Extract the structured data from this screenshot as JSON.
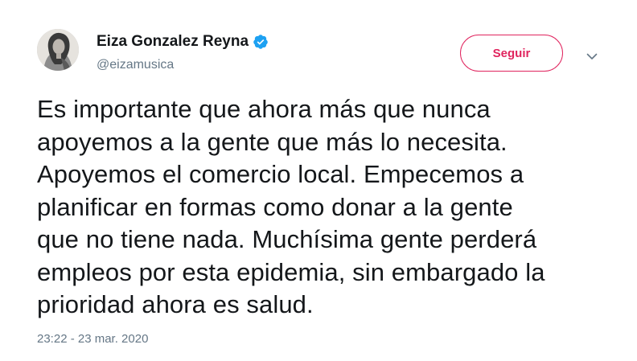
{
  "author": {
    "display_name": "Eiza Gonzalez Reyna",
    "handle": "@eizamusica",
    "verified": true
  },
  "follow_button": {
    "label": "Seguir",
    "color": "#e0245e"
  },
  "tweet": {
    "text": "Es importante que ahora más que nunca\napoyemos a la gente que más lo necesita.\nApoyemos el comercio local. Empecemos a\nplanificar en formas como donar a la gente\nque no tiene nada. Muchísima gente perderá\nempleos por esta epidemia, sin embargado la\nprioridad ahora es salud.",
    "timestamp": "23:22 - 23 mar. 2020"
  },
  "icons": {
    "verified": "verified-badge-icon",
    "caret": "chevron-down-icon"
  },
  "colors": {
    "verified_blue": "#1da1f2",
    "secondary_text": "#657786"
  }
}
